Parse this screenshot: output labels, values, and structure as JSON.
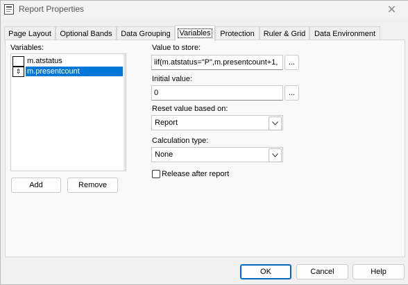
{
  "window": {
    "title": "Report Properties",
    "icon": "report-properties-icon",
    "close_glyph": "✕"
  },
  "tabs": [
    {
      "label": "Page Layout"
    },
    {
      "label": "Optional Bands"
    },
    {
      "label": "Data Grouping"
    },
    {
      "label": "Variables",
      "active": true
    },
    {
      "label": "Protection"
    },
    {
      "label": "Ruler & Grid"
    },
    {
      "label": "Data Environment"
    }
  ],
  "variables": {
    "label": "Variables:",
    "items": [
      {
        "name": "m.atstatus",
        "selected": false,
        "marker": ""
      },
      {
        "name": "m.presentcount",
        "selected": true,
        "marker": "⇕"
      }
    ],
    "add_label": "Add",
    "remove_label": "Remove"
  },
  "value_to_store": {
    "label": "Value to store:",
    "value": "iif(m.atstatus=\"P\",m.presentcount+1,",
    "button": "..."
  },
  "initial_value": {
    "label": "Initial value:",
    "value": "0",
    "button": "..."
  },
  "reset": {
    "label": "Reset value based on:",
    "value": "Report"
  },
  "calculation": {
    "label": "Calculation type:",
    "value": "None"
  },
  "release": {
    "label": "Release after report",
    "checked": false
  },
  "footer": {
    "ok_label": "OK",
    "cancel_label": "Cancel",
    "help_label": "Help"
  },
  "colors": {
    "selection": "#0078d7",
    "default_button_border": "#0067c0"
  }
}
